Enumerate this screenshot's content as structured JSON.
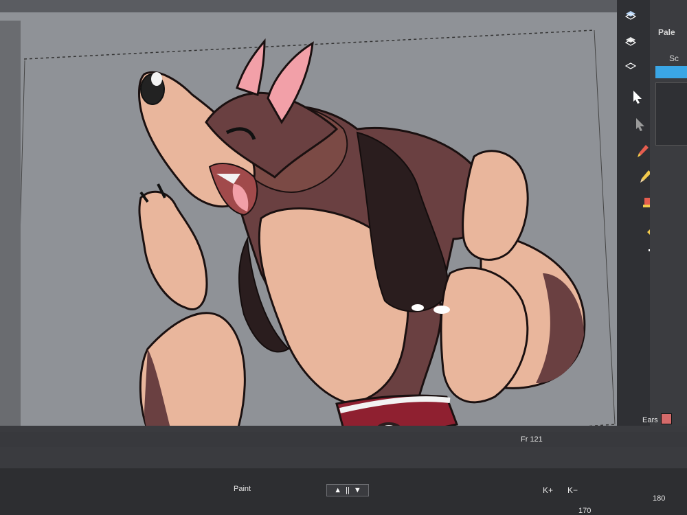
{
  "panel": {
    "title": "Pale",
    "tab": "Sc"
  },
  "viewport": {
    "frame_label": "Fr 121",
    "layer_label": "Ears"
  },
  "timeline": {
    "mode_label": "Paint",
    "frame_start": "170",
    "frame_end": "180"
  },
  "controls": {
    "key_add": "K+",
    "key_remove": "K−"
  },
  "colors": {
    "ears_swatch": "#d46a6a",
    "toolbar_bg": "#2f3034"
  },
  "icons": [
    "layers-icon",
    "layers-stack-icon",
    "select-arrow-icon",
    "contour-editor-icon",
    "brush-icon",
    "pencil-icon",
    "stamp-icon",
    "text-icon",
    "shape-icon",
    "paint-bucket-icon",
    "eyedropper-icon",
    "globe-icon",
    "hand-icon"
  ]
}
